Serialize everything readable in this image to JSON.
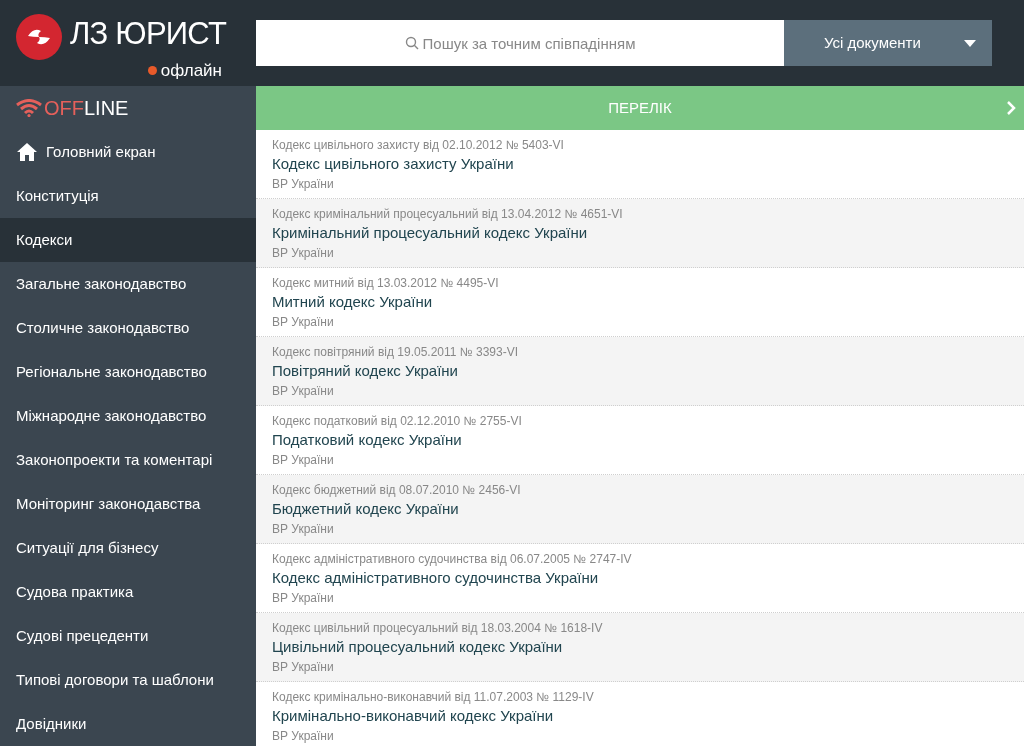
{
  "app": {
    "title": "ЛЗ ЮРИСТ",
    "status": "офлайн",
    "online": false
  },
  "search": {
    "placeholder": "Пошук за точним співпадінням"
  },
  "filter": {
    "value": "Усі документи"
  },
  "offline_banner": {
    "parts": [
      {
        "text": "OFF",
        "color": "#e5605b"
      },
      {
        "text": "LINE",
        "color": "#ffffff"
      }
    ]
  },
  "sidebar": {
    "items": [
      {
        "label": "Головний екран",
        "kind": "home",
        "selected": false
      },
      {
        "label": "Конституція",
        "kind": "plain",
        "selected": false
      },
      {
        "label": "Кодекси",
        "kind": "plain",
        "selected": true
      },
      {
        "label": "Загальне законодавство",
        "kind": "plain",
        "selected": false
      },
      {
        "label": "Столичне законодавство",
        "kind": "plain",
        "selected": false
      },
      {
        "label": "Регіональне законодавство",
        "kind": "plain",
        "selected": false
      },
      {
        "label": "Міжнародне законодавство",
        "kind": "plain",
        "selected": false
      },
      {
        "label": "Законопроекти та коментарі",
        "kind": "plain",
        "selected": false
      },
      {
        "label": "Моніторинг законодавства",
        "kind": "plain",
        "selected": false
      },
      {
        "label": "Ситуації для бізнесу",
        "kind": "plain",
        "selected": false
      },
      {
        "label": "Судова практика",
        "kind": "plain",
        "selected": false
      },
      {
        "label": "Судові прецеденти",
        "kind": "plain",
        "selected": false
      },
      {
        "label": "Типові договори та шаблони",
        "kind": "plain",
        "selected": false
      },
      {
        "label": "Довідники",
        "kind": "plain",
        "selected": false
      }
    ]
  },
  "list": {
    "title": "ПЕРЕЛІК",
    "rows": [
      {
        "meta": "Кодекс цивільного захисту від 02.10.2012 № 5403-VI",
        "title": "Кодекс цивільного захисту України",
        "issuer": "ВР України"
      },
      {
        "meta": "Кодекс кримінальний процесуальний від 13.04.2012 № 4651-VI",
        "title": "Кримінальний процесуальний кодекс України",
        "issuer": "ВР України"
      },
      {
        "meta": "Кодекс митний від 13.03.2012 № 4495-VI",
        "title": "Митний кодекс України",
        "issuer": "ВР України"
      },
      {
        "meta": "Кодекс повітряний від 19.05.2011 № 3393-VI",
        "title": "Повітряний кодекс України",
        "issuer": "ВР України"
      },
      {
        "meta": "Кодекс податковий від 02.12.2010 № 2755-VI",
        "title": "Податковий кодекс України",
        "issuer": "ВР України"
      },
      {
        "meta": "Кодекс бюджетний від 08.07.2010 № 2456-VI",
        "title": "Бюджетний кодекс України",
        "issuer": "ВР України"
      },
      {
        "meta": "Кодекс адміністративного судочинства від 06.07.2005 № 2747-IV",
        "title": "Кодекс адміністративного судочинства України",
        "issuer": "ВР України"
      },
      {
        "meta": "Кодекс цивільний процесуальний від 18.03.2004 № 1618-IV",
        "title": "Цивільний процесуальний кодекс України",
        "issuer": "ВР України"
      },
      {
        "meta": "Кодекс кримінально-виконавчий від 11.07.2003 № 1129-IV",
        "title": "Кримінально-виконавчий кодекс України",
        "issuer": "ВР України"
      }
    ]
  }
}
